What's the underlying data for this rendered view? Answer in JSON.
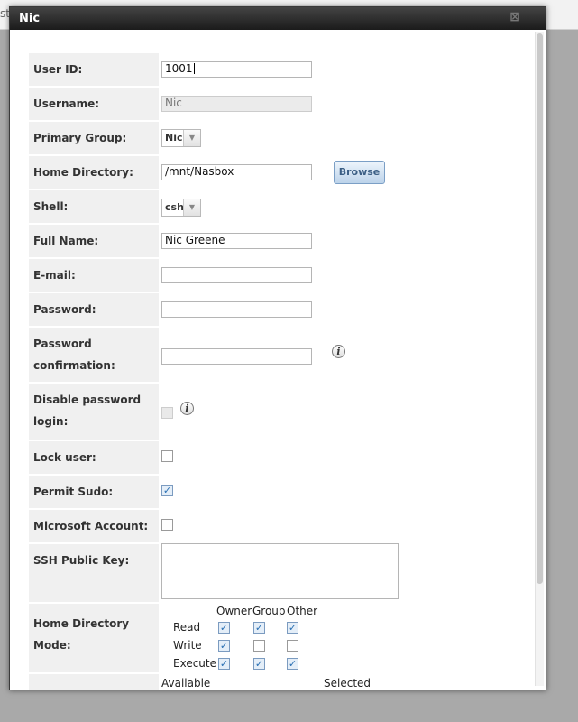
{
  "background": {
    "partial_text": "st"
  },
  "dialog": {
    "title": "Nic",
    "close_glyph": "⊠"
  },
  "fields": {
    "user_id": {
      "label": "User ID:",
      "value": "1001"
    },
    "username": {
      "label": "Username:",
      "value": "Nic"
    },
    "primary_group": {
      "label": "Primary Group:",
      "value": "Nic"
    },
    "home_directory": {
      "label": "Home Directory:",
      "value": "/mnt/Nasbox",
      "browse_label": "Browse"
    },
    "shell": {
      "label": "Shell:",
      "value": "csh"
    },
    "full_name": {
      "label": "Full Name:",
      "value": "Nic Greene"
    },
    "email": {
      "label": "E-mail:",
      "value": ""
    },
    "password": {
      "label": "Password:",
      "value": ""
    },
    "password_confirm": {
      "label_line1": "Password",
      "label_line2": "confirmation:",
      "value": ""
    },
    "disable_password_login": {
      "label_line1": "Disable password",
      "label_line2": "login:",
      "checked": false
    },
    "lock_user": {
      "label": "Lock user:",
      "checked": false
    },
    "permit_sudo": {
      "label": "Permit Sudo:",
      "checked": true
    },
    "microsoft_account": {
      "label": "Microsoft Account:",
      "checked": false
    },
    "ssh_public_key": {
      "label": "SSH Public Key:",
      "value": ""
    },
    "home_directory_mode": {
      "label_line1": "Home Directory",
      "label_line2": "Mode:",
      "columns": [
        "Owner",
        "Group",
        "Other"
      ],
      "rows": [
        {
          "name": "Read",
          "owner": true,
          "group": true,
          "other": true
        },
        {
          "name": "Write",
          "owner": true,
          "group": false,
          "other": false
        },
        {
          "name": "Execute",
          "owner": true,
          "group": true,
          "other": true
        }
      ]
    },
    "aux_groups": {
      "available_label": "Available",
      "selected_label": "Selected"
    }
  },
  "icons": {
    "info": "info-icon",
    "checkmark": "✓",
    "arrow": "▼"
  },
  "colors": {
    "title_bar": "#1b1b1b",
    "label_bg": "#f0f0f0",
    "accent": "#7b9fc6"
  }
}
